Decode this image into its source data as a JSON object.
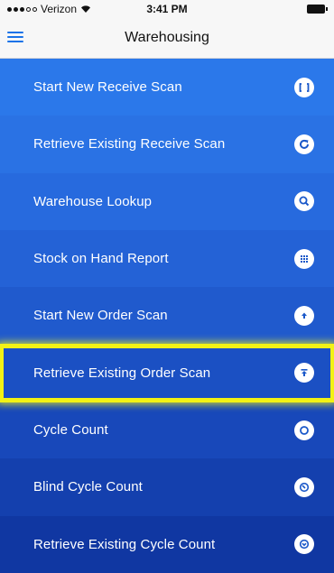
{
  "status": {
    "carrier": "Verizon",
    "time": "3:41 PM"
  },
  "header": {
    "title": "Warehousing"
  },
  "menu": {
    "items": [
      {
        "label": "Start New Receive Scan",
        "icon": "scan-bracket-icon"
      },
      {
        "label": "Retrieve Existing Receive Scan",
        "icon": "refresh-icon"
      },
      {
        "label": "Warehouse Lookup",
        "icon": "search-icon"
      },
      {
        "label": "Stock on Hand Report",
        "icon": "grid-icon"
      },
      {
        "label": "Start New Order Scan",
        "icon": "upload-arrow-icon"
      },
      {
        "label": "Retrieve Existing Order Scan",
        "icon": "upload-bar-icon"
      },
      {
        "label": "Cycle Count",
        "icon": "circle-icon"
      },
      {
        "label": "Blind Cycle Count",
        "icon": "clock-icon"
      },
      {
        "label": "Retrieve Existing Cycle Count",
        "icon": "chevron-circle-icon"
      }
    ],
    "colors": [
      "#2b78ea",
      "#2a72e4",
      "#276ade",
      "#2462d6",
      "#205acd",
      "#1b50c3",
      "#1848ba",
      "#1440ae",
      "#1037a2"
    ],
    "icon_color": "#1a58c9",
    "highlight_color": "#f2f215"
  }
}
